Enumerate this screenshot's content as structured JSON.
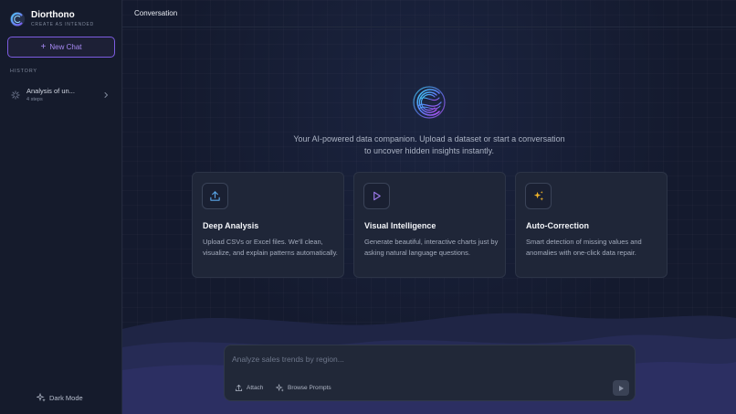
{
  "brand": {
    "name": "Diorthono",
    "tagline": "CREATE AS INTENDED"
  },
  "sidebar": {
    "new_chat_label": "New Chat",
    "history_label": "HISTORY",
    "history": [
      {
        "title": "Analysis of un...",
        "steps": "4 steps"
      }
    ],
    "dark_mode_label": "Dark Mode"
  },
  "header": {
    "title": "Conversation"
  },
  "hero": {
    "intro": "Your AI-powered data companion. Upload a dataset or start a conversation to uncover hidden insights instantly."
  },
  "cards": [
    {
      "icon": "upload-icon",
      "title": "Deep Analysis",
      "description": "Upload CSVs or Excel files. We'll clean, visualize, and explain patterns automatically."
    },
    {
      "icon": "play-icon",
      "title": "Visual Intelligence",
      "description": "Generate beautiful, interactive charts just by asking natural language questions."
    },
    {
      "icon": "sparkle-icon",
      "title": "Auto-Correction",
      "description": "Smart detection of missing values and anomalies with one-click data repair."
    }
  ],
  "composer": {
    "placeholder": "Analyze sales trends by region...",
    "value": "",
    "attach_label": "Attach",
    "prompts_label": "Browse Prompts"
  },
  "colors": {
    "accent": "#7c5ce0",
    "upload_icon": "#5aa6e8",
    "play_icon": "#a07cf0",
    "sparkle_icon": "#f0b429"
  }
}
